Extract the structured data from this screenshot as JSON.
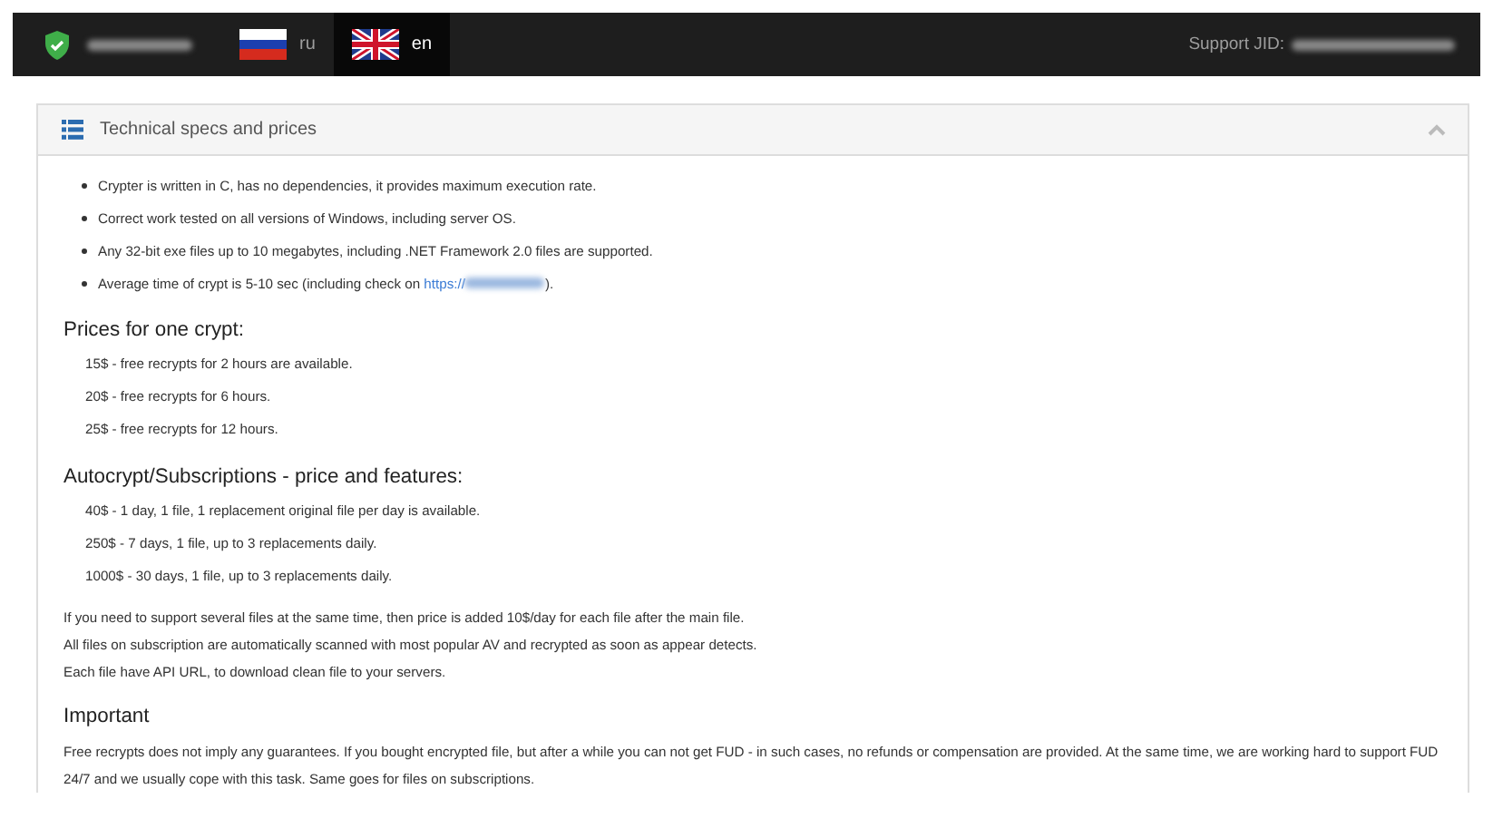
{
  "navbar": {
    "languages": [
      {
        "label": "ru",
        "kind": "ru",
        "selected": false
      },
      {
        "label": "en",
        "kind": "gb",
        "selected": true
      }
    ],
    "support_label": "Support JID:"
  },
  "panel": {
    "title": "Technical specs and prices",
    "expanded": true,
    "bullets": [
      {
        "text": "Crypter is written in C, has no dependencies, it provides maximum execution rate."
      },
      {
        "text": "Correct work tested on all versions of Windows, including server OS."
      },
      {
        "text": "Any 32-bit exe files up to 10 megabytes, including .NET Framework 2.0 files are supported."
      },
      {
        "text": "Average time of crypt is 5-10 sec (including check on ",
        "link": "https://",
        "tail": ")."
      }
    ],
    "sections": [
      {
        "heading": "Prices for one crypt:",
        "items": [
          "15$ - free recrypts for 2 hours are available.",
          "20$ - free recrypts for 6 hours.",
          "25$ - free recrypts for 12 hours."
        ]
      },
      {
        "heading": "Autocrypt/Subscriptions - price and features:",
        "items": [
          "40$ - 1 day, 1 file, 1 replacement original file per day is available.",
          "250$ - 7 days, 1 file, up to 3 replacements daily.",
          "1000$ - 30 days, 1 file, up to 3 replacements daily."
        ],
        "paragraphs": [
          "If you need to support several files at the same time, then price is added 10$/day for each file after the main file.\nAll files on subscription are automatically scanned with most popular AV and recrypted as soon as appear detects.\nEach file have API URL, to download clean file to your servers."
        ]
      },
      {
        "heading": "Important",
        "paragraphs": [
          "Free recrypts does not imply any guarantees. If you bought encrypted file, but after a while you can not get FUD - in such cases, no refunds or compensation are provided. At the same time, we are working hard to support FUD 24/7 and we usually cope with this task. Same goes for files on subscriptions."
        ]
      }
    ]
  }
}
